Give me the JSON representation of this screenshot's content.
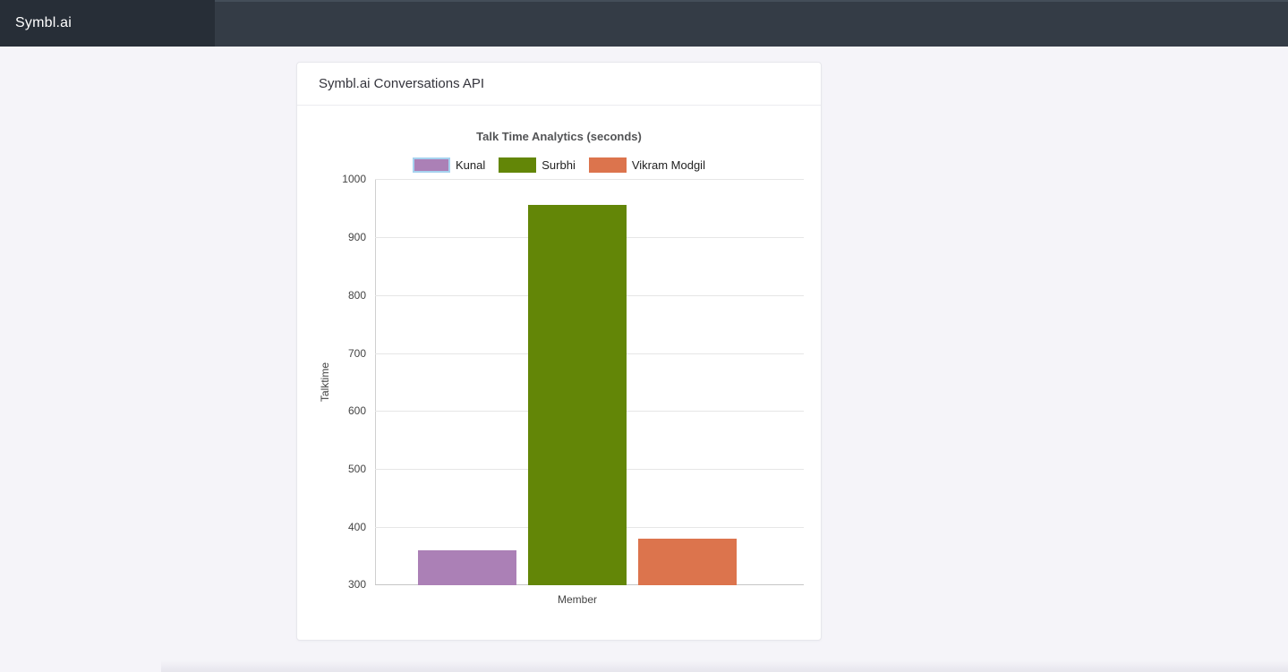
{
  "navbar": {
    "brand": "Symbl.ai"
  },
  "card": {
    "title": "Symbl.ai Conversations API"
  },
  "chart_data": {
    "type": "bar",
    "title": "Talk Time Analytics (seconds)",
    "xlabel": "Member",
    "ylabel": "Talktime",
    "categories": [
      "Member"
    ],
    "series": [
      {
        "name": "Kunal",
        "value": 360,
        "color": "#ab80b6",
        "highlighted": true
      },
      {
        "name": "Surbhi",
        "value": 956,
        "color": "#638607",
        "highlighted": false
      },
      {
        "name": "Vikram Modgil",
        "value": 380,
        "color": "#dc744d",
        "highlighted": false
      }
    ],
    "ylim": [
      300,
      1000
    ],
    "ytick_step": 100,
    "grid": true,
    "legend_position": "top",
    "highlight_border": "#a6d2ef"
  },
  "colors": {
    "navbar_bg": "#343c46",
    "brand_bg": "#272e37",
    "page_bg": "#f5f4f9",
    "card_border": "#e7e7ec"
  }
}
